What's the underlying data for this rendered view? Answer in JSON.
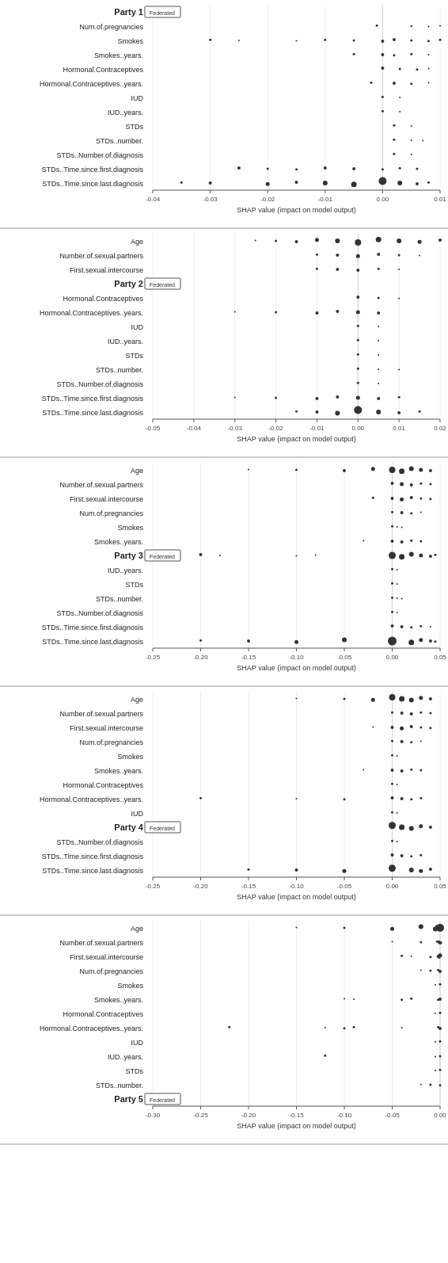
{
  "charts": [
    {
      "id": "party1",
      "party_label": "Party 1",
      "badge": "Federated",
      "rows": [
        {
          "label": "Num.of.pregnancies",
          "bold": false,
          "dots": [
            {
              "x": 0.72,
              "size": 2,
              "spread": 0.05
            }
          ]
        },
        {
          "label": "Smokes",
          "bold": false,
          "dots": [
            {
              "x": 0.1,
              "size": 3,
              "spread": 0.15
            }
          ]
        },
        {
          "label": "Smokes..years.",
          "bold": false,
          "dots": [
            {
              "x": 0.45,
              "size": 2,
              "spread": 0.08
            }
          ]
        },
        {
          "label": "Hormonal.Contraceptives",
          "bold": false,
          "dots": [
            {
              "x": 0.5,
              "size": 2,
              "spread": 0.06
            }
          ]
        },
        {
          "label": "Hormonal.Contraceptives..years.",
          "bold": false,
          "dots": [
            {
              "x": 0.45,
              "size": 2,
              "spread": 0.06
            }
          ]
        },
        {
          "label": "IUD",
          "bold": false,
          "dots": [
            {
              "x": 0.5,
              "size": 2,
              "spread": 0.05
            }
          ]
        },
        {
          "label": "IUD..years.",
          "bold": false,
          "dots": [
            {
              "x": 0.5,
              "size": 2,
              "spread": 0.05
            }
          ]
        },
        {
          "label": "STDs",
          "bold": false,
          "dots": [
            {
              "x": 0.5,
              "size": 2,
              "spread": 0.05
            }
          ]
        },
        {
          "label": "STDs..number.",
          "bold": false,
          "dots": [
            {
              "x": 0.5,
              "size": 2,
              "spread": 0.05
            }
          ]
        },
        {
          "label": "STDs..Number.of.diagnosis",
          "bold": false,
          "dots": [
            {
              "x": 0.5,
              "size": 2,
              "spread": 0.05
            }
          ]
        },
        {
          "label": "STDs..Time.since.first.diagnosis",
          "bold": false,
          "dots": [
            {
              "x": 0.3,
              "size": 3,
              "spread": 0.12
            }
          ]
        },
        {
          "label": "STDs..Time.since.last.diagnosis",
          "bold": false,
          "dots": [
            {
              "x": 0.55,
              "size": 5,
              "spread": 0.2
            }
          ]
        }
      ],
      "party_row_index": 0,
      "xmin": -0.04,
      "xmax": 0.01,
      "xticks": [
        -0.04,
        -0.03,
        -0.02,
        -0.01,
        0.0,
        0.01
      ],
      "xlabel": "SHAP value (impact on model output)"
    },
    {
      "id": "party2",
      "party_label": "Party 2",
      "badge": "Federated",
      "rows": [
        {
          "label": "Age",
          "bold": false,
          "dots": [
            {
              "x": 0.75,
              "size": 4,
              "spread": 0.18
            }
          ]
        },
        {
          "label": "Number.of.sexual.partners",
          "bold": false,
          "dots": [
            {
              "x": 0.6,
              "size": 3,
              "spread": 0.1
            }
          ]
        },
        {
          "label": "First.sexual.intercourse",
          "bold": false,
          "dots": [
            {
              "x": 0.55,
              "size": 3,
              "spread": 0.08
            }
          ]
        },
        {
          "label": "Hormonal.Contraceptives",
          "bold": false,
          "dots": [
            {
              "x": 0.55,
              "size": 2,
              "spread": 0.06
            }
          ]
        },
        {
          "label": "Hormonal.Contraceptives..years.",
          "bold": false,
          "dots": [
            {
              "x": 0.25,
              "size": 3,
              "spread": 0.12
            }
          ]
        },
        {
          "label": "IUD",
          "bold": false,
          "dots": [
            {
              "x": 0.55,
              "size": 2,
              "spread": 0.05
            }
          ]
        },
        {
          "label": "IUD..years.",
          "bold": false,
          "dots": [
            {
              "x": 0.55,
              "size": 2,
              "spread": 0.05
            }
          ]
        },
        {
          "label": "STDs",
          "bold": false,
          "dots": [
            {
              "x": 0.55,
              "size": 2,
              "spread": 0.05
            }
          ]
        },
        {
          "label": "STDs..number.",
          "bold": false,
          "dots": [
            {
              "x": 0.55,
              "size": 2,
              "spread": 0.05
            }
          ]
        },
        {
          "label": "STDs..Number.of.diagnosis",
          "bold": false,
          "dots": [
            {
              "x": 0.55,
              "size": 2,
              "spread": 0.05
            }
          ]
        },
        {
          "label": "STDs..Time.since.first.diagnosis",
          "bold": false,
          "dots": [
            {
              "x": 0.35,
              "size": 3,
              "spread": 0.12
            }
          ]
        },
        {
          "label": "STDs..Time.since.last.diagnosis",
          "bold": false,
          "dots": [
            {
              "x": 0.55,
              "size": 5,
              "spread": 0.2
            }
          ]
        }
      ],
      "party_row_index": 3,
      "xmin": -0.05,
      "xmax": 0.02,
      "xticks": [
        -0.05,
        -0.04,
        -0.03,
        -0.02,
        -0.01,
        0.0,
        0.01,
        0.02
      ],
      "xlabel": "SHAP value (impact on model output)"
    },
    {
      "id": "party3",
      "party_label": "Party 3",
      "badge": "Federated",
      "rows": [
        {
          "label": "Age",
          "bold": false
        },
        {
          "label": "Number.of.sexual.partners",
          "bold": false
        },
        {
          "label": "First.sexual.intercourse",
          "bold": false
        },
        {
          "label": "Num.of.pregnancies",
          "bold": false
        },
        {
          "label": "Smokes",
          "bold": false
        },
        {
          "label": "Smokes..years.",
          "bold": false
        },
        {
          "label": "IUD..years.",
          "bold": false
        },
        {
          "label": "STDs",
          "bold": false
        },
        {
          "label": "STDs..number.",
          "bold": false
        },
        {
          "label": "STDs..Number.of.diagnosis",
          "bold": false
        },
        {
          "label": "STDs..Time.since.first.diagnosis",
          "bold": false
        },
        {
          "label": "STDs..Time.since.last.diagnosis",
          "bold": false
        }
      ],
      "party_row_index": 6,
      "xmin": -0.25,
      "xmax": 0.05,
      "xticks": [
        -0.25,
        -0.2,
        -0.15,
        -0.1,
        -0.05,
        0.0,
        0.05
      ],
      "xlabel": "SHAP value (impact on model output)"
    },
    {
      "id": "party4",
      "party_label": "Party 4",
      "badge": "Federated",
      "rows": [
        {
          "label": "Age",
          "bold": false
        },
        {
          "label": "Number.of.sexual.partners",
          "bold": false
        },
        {
          "label": "First.sexual.intercourse",
          "bold": false
        },
        {
          "label": "Num.of.pregnancies",
          "bold": false
        },
        {
          "label": "Smokes",
          "bold": false
        },
        {
          "label": "Smokes..years.",
          "bold": false
        },
        {
          "label": "Hormonal.Contraceptives",
          "bold": false
        },
        {
          "label": "Hormonal.Contraceptives..years.",
          "bold": false
        },
        {
          "label": "IUD",
          "bold": false
        },
        {
          "label": "STDs..Number.of.diagnosis",
          "bold": false
        },
        {
          "label": "STDs..Time.since.first.diagnosis",
          "bold": false
        },
        {
          "label": "STDs..Time.since.last.diagnosis",
          "bold": false
        }
      ],
      "party_row_index": 9,
      "xmin": -0.25,
      "xmax": 0.05,
      "xticks": [
        -0.25,
        -0.2,
        -0.15,
        -0.1,
        -0.05,
        0.0,
        0.05
      ],
      "xlabel": "SHAP value (impact on model output)"
    },
    {
      "id": "party5",
      "party_label": "Party 5",
      "badge": "Federated",
      "rows": [
        {
          "label": "Age",
          "bold": false
        },
        {
          "label": "Number.of.sexual.partners",
          "bold": false
        },
        {
          "label": "First.sexual.intercourse",
          "bold": false
        },
        {
          "label": "Num.of.pregnancies",
          "bold": false
        },
        {
          "label": "Smokes",
          "bold": false
        },
        {
          "label": "Smokes..years.",
          "bold": false
        },
        {
          "label": "Hormonal.Contraceptives",
          "bold": false
        },
        {
          "label": "Hormonal.Contraceptives..years.",
          "bold": false
        },
        {
          "label": "IUD",
          "bold": false
        },
        {
          "label": "IUD..years.",
          "bold": false
        },
        {
          "label": "STDs",
          "bold": false
        },
        {
          "label": "STDs..number.",
          "bold": false
        }
      ],
      "party_row_index": 12,
      "xmin": -0.3,
      "xmax": 0.0,
      "xticks": [
        -0.3,
        -0.25,
        -0.2,
        -0.15,
        -0.1,
        -0.05,
        0.0
      ],
      "xlabel": "SHAP value (impact on model output)"
    }
  ]
}
